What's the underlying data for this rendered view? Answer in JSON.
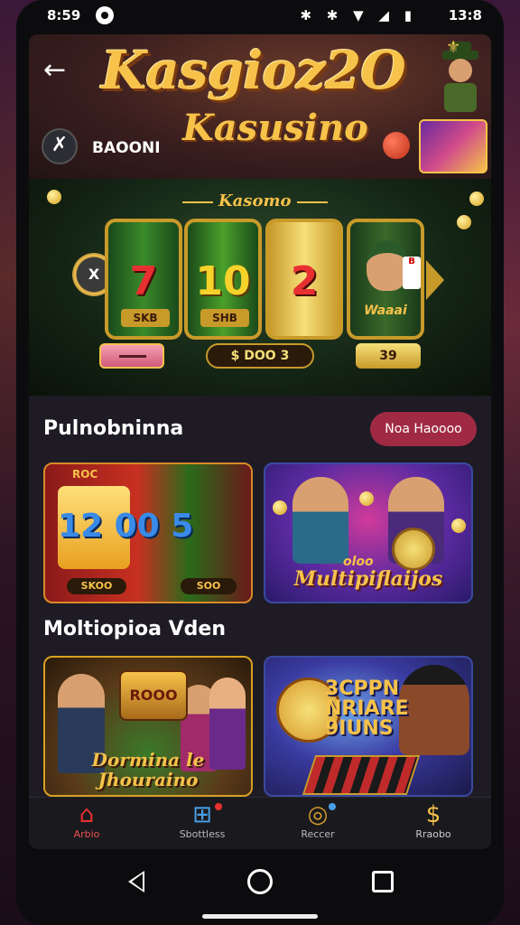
{
  "status_bar": {
    "time": "8:59",
    "battery_text": "13:8",
    "icons_text": "✱ ✱ ▼ ◢ ▮"
  },
  "header": {
    "logo_line1": "Kasgioz2O",
    "logo_line2": "Kasusino",
    "subtitle": "BAOONI",
    "back_icon": "arrow-left-icon",
    "menu_icon": "tools-icon"
  },
  "slot_machine": {
    "label": "Kasomo",
    "reels": [
      {
        "symbol": "7",
        "sub": "SKB"
      },
      {
        "symbol": "10",
        "sub": "SHB"
      },
      {
        "symbol": "2",
        "sub": ""
      },
      {
        "symbol": "",
        "sub": "Waaai"
      }
    ],
    "chip_text": "X",
    "bet_text": "$ DOO 3",
    "win_text": "39",
    "card_text": "B"
  },
  "section1": {
    "title": "Pulnobninna",
    "action_label": "Noa Haoooo",
    "cards": [
      {
        "header": "ROC",
        "big_text": "12 00 5",
        "chip_left": "SKOO",
        "chip_right": "SOO"
      },
      {
        "small_text": "oloo",
        "title": "Multipiflaijos"
      }
    ]
  },
  "section2": {
    "title": "Moltiopioa Vden",
    "cards": [
      {
        "sign": "ROOO",
        "title": "Dormina le Jhouraino"
      },
      {
        "title": "3CPPN NRIARE 9IUNS"
      }
    ]
  },
  "tab_bar": {
    "tabs": [
      {
        "label": "Arbio",
        "icon": "home-icon"
      },
      {
        "label": "Sbottless",
        "icon": "grid-icon"
      },
      {
        "label": "Reccer",
        "icon": "trophy-icon"
      },
      {
        "label": "Rraobo",
        "icon": "dollar-icon"
      }
    ]
  },
  "colors": {
    "accent_gold": "#f6c24a",
    "pill_red": "#a02a44",
    "screen_bg": "#1e1b24"
  }
}
